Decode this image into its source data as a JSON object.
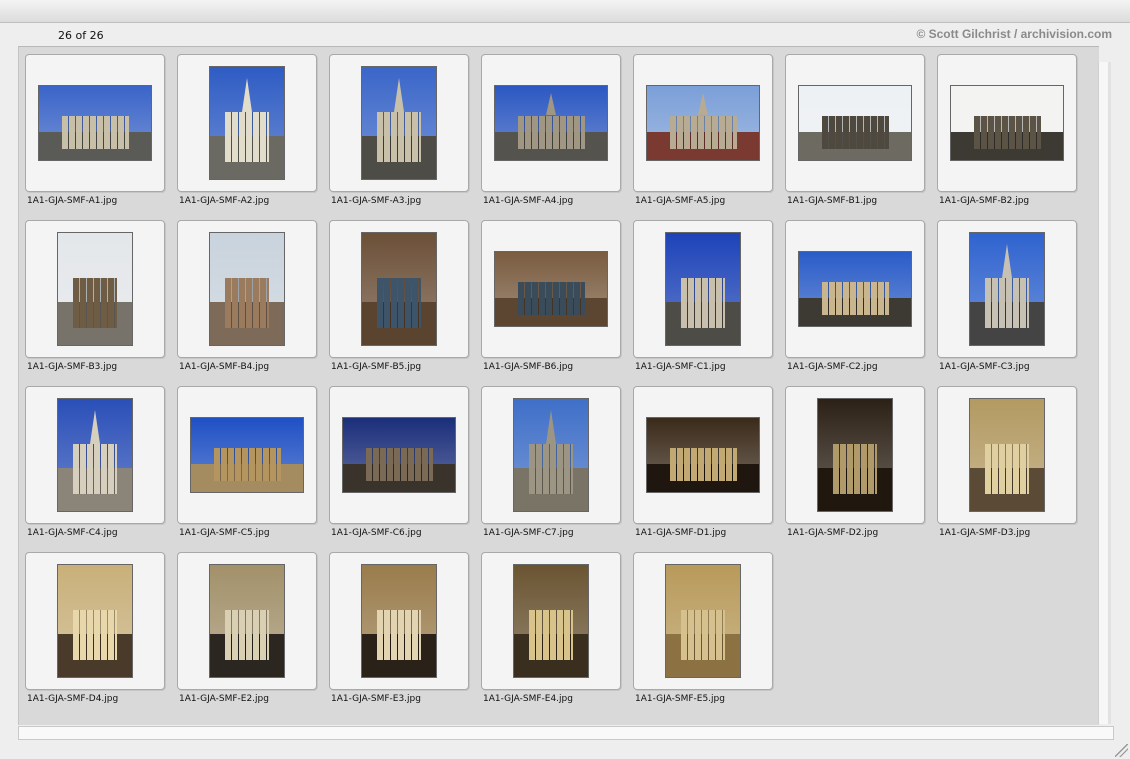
{
  "header": {
    "count_text": "26 of 26",
    "credit_text": "© Scott Gilchrist / archivision.com"
  },
  "thumbnails": [
    {
      "filename": "1A1-GJA-SMF-A1.jpg",
      "orientation": "landscape",
      "sky": "#3a64c8",
      "ground": "#5a5a56",
      "bldg": "#c7bfa8",
      "spire": false
    },
    {
      "filename": "1A1-GJA-SMF-A2.jpg",
      "orientation": "portrait",
      "sky": "#2e5cc4",
      "ground": "#6a6a62",
      "bldg": "#e2dccb",
      "spire": true
    },
    {
      "filename": "1A1-GJA-SMF-A3.jpg",
      "orientation": "portrait",
      "sky": "#3a66c9",
      "ground": "#4e4c46",
      "bldg": "#c9c0aa",
      "spire": true
    },
    {
      "filename": "1A1-GJA-SMF-A4.jpg",
      "orientation": "landscape",
      "sky": "#2c58c2",
      "ground": "#55534d",
      "bldg": "#9f9684",
      "spire": true
    },
    {
      "filename": "1A1-GJA-SMF-A5.jpg",
      "orientation": "landscape",
      "sky": "#7b9fd8",
      "ground": "#7a3a32",
      "bldg": "#b7ab94",
      "spire": true
    },
    {
      "filename": "1A1-GJA-SMF-B1.jpg",
      "orientation": "landscape",
      "sky": "#eef1f4",
      "ground": "#6d6a62",
      "bldg": "#4e483e",
      "spire": false
    },
    {
      "filename": "1A1-GJA-SMF-B2.jpg",
      "orientation": "landscape",
      "sky": "#f3f3f1",
      "ground": "#3d3a33",
      "bldg": "#5a5346",
      "spire": false
    },
    {
      "filename": "1A1-GJA-SMF-B3.jpg",
      "orientation": "portrait",
      "sky": "#e4e7ea",
      "ground": "#77736a",
      "bldg": "#6f5c44",
      "spire": false
    },
    {
      "filename": "1A1-GJA-SMF-B4.jpg",
      "orientation": "portrait",
      "sky": "#c9d3dd",
      "ground": "#7d6a58",
      "bldg": "#9a7b5e",
      "spire": false
    },
    {
      "filename": "1A1-GJA-SMF-B5.jpg",
      "orientation": "portrait",
      "sky": "#6c5038",
      "ground": "#5a4430",
      "bldg": "#3e5468",
      "spire": false
    },
    {
      "filename": "1A1-GJA-SMF-B6.jpg",
      "orientation": "landscape",
      "sky": "#7a5c40",
      "ground": "#5c4632",
      "bldg": "#3a4c5a",
      "spire": false
    },
    {
      "filename": "1A1-GJA-SMF-C1.jpg",
      "orientation": "portrait",
      "sky": "#1d43b8",
      "ground": "#4e4c46",
      "bldg": "#c8c0ad",
      "spire": false
    },
    {
      "filename": "1A1-GJA-SMF-C2.jpg",
      "orientation": "landscape",
      "sky": "#2a5cc8",
      "ground": "#3d3a33",
      "bldg": "#c9b68e",
      "spire": false
    },
    {
      "filename": "1A1-GJA-SMF-C3.jpg",
      "orientation": "portrait",
      "sky": "#2f63cf",
      "ground": "#444",
      "bldg": "#c7c1b3",
      "spire": true
    },
    {
      "filename": "1A1-GJA-SMF-C4.jpg",
      "orientation": "portrait",
      "sky": "#2a4fb8",
      "ground": "#8b8579",
      "bldg": "#d6cfbe",
      "spire": true
    },
    {
      "filename": "1A1-GJA-SMF-C5.jpg",
      "orientation": "landscape",
      "sky": "#1f50c4",
      "ground": "#a58b60",
      "bldg": "#b5955f",
      "spire": false
    },
    {
      "filename": "1A1-GJA-SMF-C6.jpg",
      "orientation": "landscape",
      "sky": "#1b2e7a",
      "ground": "#3a332b",
      "bldg": "#7a6a55",
      "spire": false
    },
    {
      "filename": "1A1-GJA-SMF-C7.jpg",
      "orientation": "portrait",
      "sky": "#3f6fc8",
      "ground": "#7a7466",
      "bldg": "#9c9584",
      "spire": true
    },
    {
      "filename": "1A1-GJA-SMF-D1.jpg",
      "orientation": "landscape",
      "sky": "#3a2a1a",
      "ground": "#1e160f",
      "bldg": "#c2a872",
      "spire": false
    },
    {
      "filename": "1A1-GJA-SMF-D2.jpg",
      "orientation": "portrait",
      "sky": "#2c2116",
      "ground": "#20170f",
      "bldg": "#b09a6a",
      "spire": false
    },
    {
      "filename": "1A1-GJA-SMF-D3.jpg",
      "orientation": "portrait",
      "sky": "#b39a62",
      "ground": "#5a4a36",
      "bldg": "#e0cfa0",
      "spire": false
    },
    {
      "filename": "1A1-GJA-SMF-D4.jpg",
      "orientation": "portrait",
      "sky": "#c9b07a",
      "ground": "#4a3a2a",
      "bldg": "#e7d7aa",
      "spire": false
    },
    {
      "filename": "1A1-GJA-SMF-E2.jpg",
      "orientation": "portrait",
      "sky": "#a2916a",
      "ground": "#2b2620",
      "bldg": "#d9cfb2",
      "spire": false
    },
    {
      "filename": "1A1-GJA-SMF-E3.jpg",
      "orientation": "portrait",
      "sky": "#9a7c4c",
      "ground": "#2a2118",
      "bldg": "#e2d4b0",
      "spire": false
    },
    {
      "filename": "1A1-GJA-SMF-E4.jpg",
      "orientation": "portrait",
      "sky": "#6a5432",
      "ground": "#3a2e1e",
      "bldg": "#d8c38a",
      "spire": false
    },
    {
      "filename": "1A1-GJA-SMF-E5.jpg",
      "orientation": "portrait",
      "sky": "#b89a5a",
      "ground": "#8c7242",
      "bldg": "#d6c08e",
      "spire": false
    }
  ]
}
